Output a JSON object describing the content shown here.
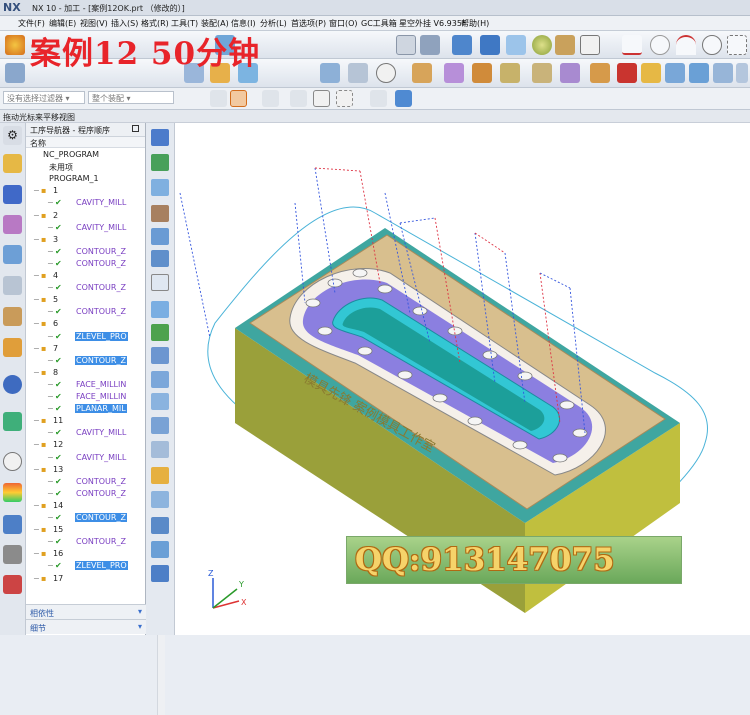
{
  "app": {
    "logo": "NX",
    "title": "NX 10 - 加工 - [案例12OK.prt （修改的）]"
  },
  "menu": [
    "文件(F)",
    "编辑(E)",
    "视图(V)",
    "插入(S)",
    "格式(R)",
    "工具(T)",
    "装配(A)",
    "信息(I)",
    "分析(L)",
    "首选项(P)",
    "窗口(O)",
    "GC工具箱",
    "星空外挂 V6.935F",
    "帮助(H)"
  ],
  "overlay_title": "案例12  50分钟",
  "selection_bar": {
    "filter_placeholder": "没有选择过滤器",
    "assembly_placeholder": "整个装配"
  },
  "status_hint": "拖动光标来平移视图",
  "navigator": {
    "title": "工序导航器 - 程序顺序",
    "column_header": "名称",
    "tree": [
      {
        "label": "NC_PROGRAM",
        "level": 0
      },
      {
        "label": "未用项",
        "level": 1
      },
      {
        "label": "PROGRAM_1",
        "level": 1
      },
      {
        "label": "1",
        "level": 2
      },
      {
        "label": "CAVITY_MILL",
        "level": 3,
        "op": true
      },
      {
        "label": "2",
        "level": 2
      },
      {
        "label": "CAVITY_MILL",
        "level": 3,
        "op": true
      },
      {
        "label": "3",
        "level": 2
      },
      {
        "label": "CONTOUR_Z",
        "level": 3,
        "op": true
      },
      {
        "label": "CONTOUR_Z",
        "level": 3
      },
      {
        "label": "4",
        "level": 2
      },
      {
        "label": "CONTOUR_Z",
        "level": 3,
        "op": true
      },
      {
        "label": "5",
        "level": 2
      },
      {
        "label": "CONTOUR_Z",
        "level": 3,
        "op": true
      },
      {
        "label": "6",
        "level": 2
      },
      {
        "label": "ZLEVEL_PRO",
        "level": 3,
        "sel": true
      },
      {
        "label": "7",
        "level": 2
      },
      {
        "label": "CONTOUR_Z",
        "level": 3,
        "sel": true
      },
      {
        "label": "8",
        "level": 2
      },
      {
        "label": "FACE_MILLIN",
        "level": 3,
        "op": true
      },
      {
        "label": "FACE_MILLIN",
        "level": 3
      },
      {
        "label": "PLANAR_MIL",
        "level": 3,
        "sel": true
      },
      {
        "label": "11",
        "level": 2
      },
      {
        "label": "CAVITY_MILL",
        "level": 3,
        "op": true
      },
      {
        "label": "12",
        "level": 2
      },
      {
        "label": "CAVITY_MILL",
        "level": 3,
        "op": true
      },
      {
        "label": "13",
        "level": 2
      },
      {
        "label": "CONTOUR_Z",
        "level": 3,
        "op": true
      },
      {
        "label": "CONTOUR_Z",
        "level": 3
      },
      {
        "label": "14",
        "level": 2
      },
      {
        "label": "CONTOUR_Z",
        "level": 3,
        "sel": true
      },
      {
        "label": "15",
        "level": 2
      },
      {
        "label": "CONTOUR_Z",
        "level": 3,
        "op": true
      },
      {
        "label": "16",
        "level": 2
      },
      {
        "label": "ZLEVEL_PRO",
        "level": 3,
        "sel": true
      },
      {
        "label": "17",
        "level": 2
      }
    ],
    "panel_dependencies": "相依性",
    "panel_details": "细节"
  },
  "viewport": {
    "part_text_front": "模具先锋  案例模具工作室",
    "axis_labels": [
      "Z",
      "Y",
      "X"
    ]
  },
  "watermark": "QQ:913147075",
  "colors": {
    "part_base": "#b9b73a",
    "plate": "#d7b98c",
    "pocket_purple": "#8b7fe0",
    "pocket_cyan": "#33c8d6",
    "toolpath_blue": "#3355dd",
    "toolpath_red": "#dd3344",
    "selection": "#3d8ee6",
    "title_red": "#e8242a"
  }
}
